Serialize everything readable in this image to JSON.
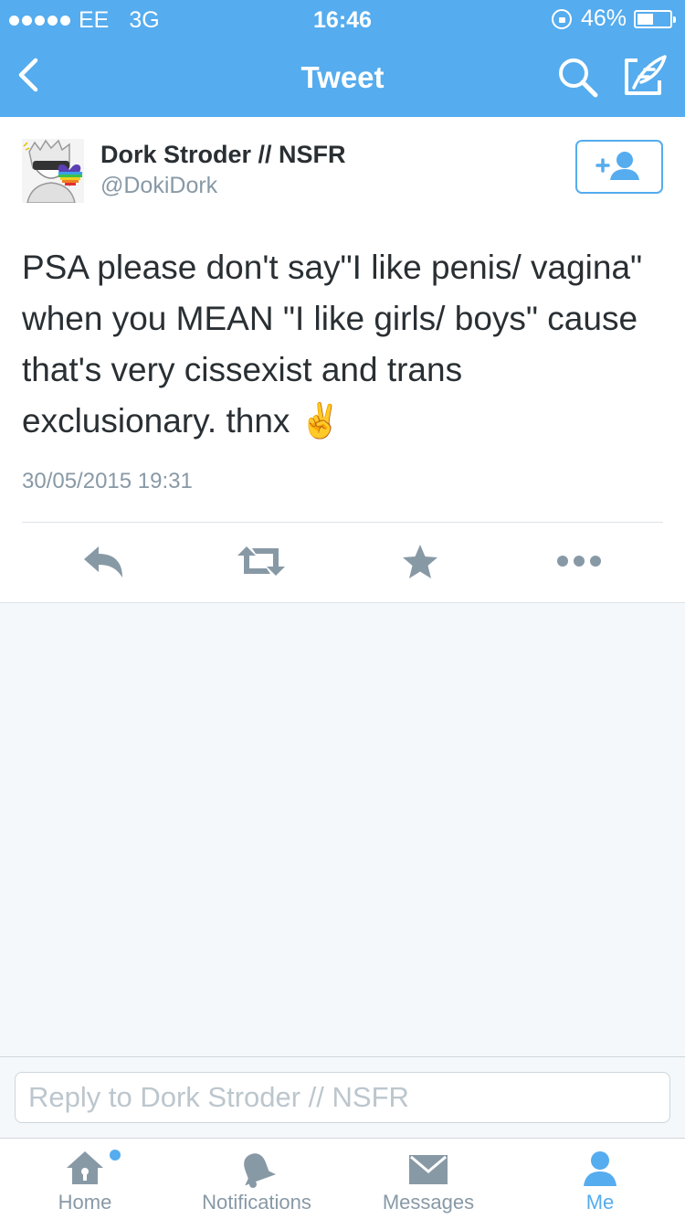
{
  "status_bar": {
    "signal_dots": 5,
    "carrier": "EE",
    "network": "3G",
    "time": "16:46",
    "battery_percent": "46%",
    "battery_level": 0.46
  },
  "nav": {
    "title": "Tweet",
    "back_icon": "chevron-left-icon",
    "search_icon": "search-icon",
    "compose_icon": "compose-icon"
  },
  "tweet": {
    "author_name": "Dork Stroder // NSFR",
    "author_handle": "@DokiDork",
    "text": "PSA please don't say\"I like penis/ vagina\" when you MEAN \"I like girls/ boys\" cause that's very cissexist and trans exclusionary. thnx ✌️",
    "timestamp": "30/05/2015 19:31",
    "follow_icon": "add-user-icon",
    "actions": [
      "reply-icon",
      "retweet-icon",
      "favorite-icon",
      "more-icon"
    ]
  },
  "composer": {
    "placeholder": "Reply to Dork Stroder // NSFR"
  },
  "tabs": [
    {
      "label": "Home",
      "icon": "home-icon",
      "has_badge": true
    },
    {
      "label": "Notifications",
      "icon": "bell-icon"
    },
    {
      "label": "Messages",
      "icon": "envelope-icon"
    },
    {
      "label": "Me",
      "icon": "person-icon",
      "active": true
    }
  ],
  "colors": {
    "brand": "#55acee",
    "text": "#292f33",
    "secondary": "#8899a6",
    "background": "#f5f8fa"
  }
}
